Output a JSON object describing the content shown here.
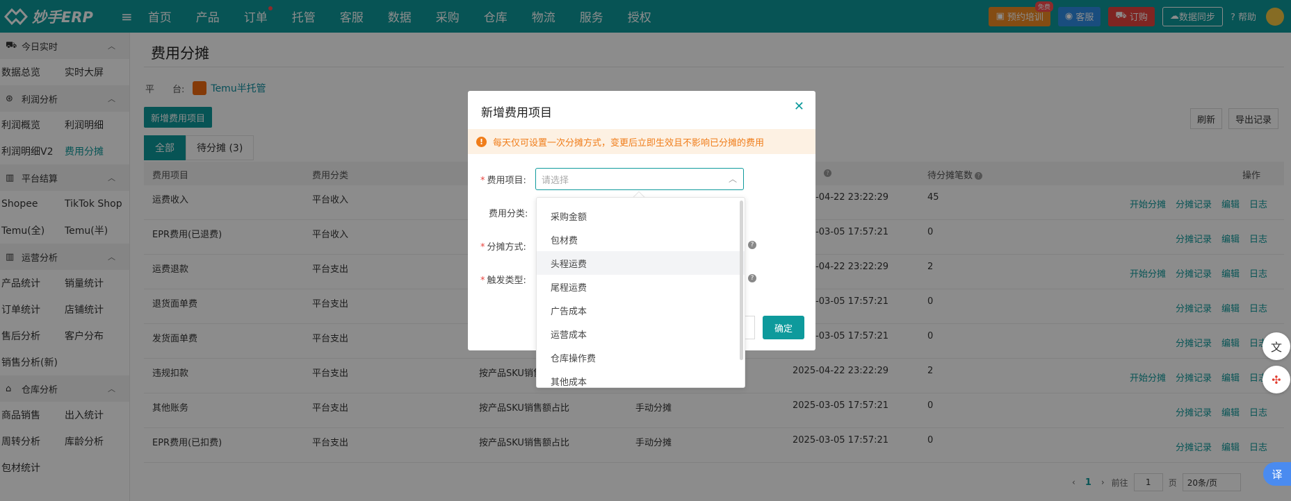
{
  "app": {
    "name": "妙手ERP"
  },
  "nav": [
    "首页",
    "产品",
    "订单",
    "托管",
    "客服",
    "数据",
    "采购",
    "仓库",
    "物流",
    "服务",
    "授权"
  ],
  "top_right": {
    "train": "预约培训",
    "free_badge": "免费",
    "service": "客服",
    "order": "订购",
    "sync": "数据同步",
    "help": "帮助"
  },
  "sidebar": {
    "groups": [
      {
        "title": "今日实时",
        "rows": [
          [
            "数据总览",
            "实时大屏"
          ]
        ]
      },
      {
        "title": "利润分析",
        "rows": [
          [
            "利润概览",
            "利润明细"
          ],
          [
            "利润明细V2",
            "费用分摊"
          ]
        ]
      },
      {
        "title": "平台结算",
        "rows": [
          [
            "Shopee",
            "TikTok Shop"
          ],
          [
            "Temu(全)",
            "Temu(半)"
          ]
        ]
      },
      {
        "title": "运营分析",
        "rows": [
          [
            "产品统计",
            "销量统计"
          ],
          [
            "订单统计",
            "店铺统计"
          ],
          [
            "售后分析",
            "客户分布"
          ],
          [
            "销售分析(新)",
            ""
          ]
        ]
      },
      {
        "title": "仓库分析",
        "rows": [
          [
            "商品销售",
            "出入统计"
          ],
          [
            "周转分析",
            "库龄分析"
          ],
          [
            "包材统计",
            ""
          ]
        ]
      }
    ],
    "active": "费用分摊"
  },
  "page": {
    "title": "费用分摊",
    "platform_label": "平　　台:",
    "platform_value": "Temu半托管",
    "add_button": "新增费用项目",
    "tabs": [
      "全部",
      "待分摊 (3)"
    ],
    "refresh": "刷新",
    "export": "导出记录"
  },
  "table": {
    "headers": [
      "费用项目",
      "费用分类",
      "",
      "",
      "",
      "待分摊笔数",
      "操作"
    ],
    "rows": [
      {
        "item": "运费收入",
        "cat": "平台收入",
        "method": "",
        "type": "",
        "time": "2025-04-22 23:22:29",
        "pending": "45",
        "ops": [
          "开始分摊",
          "分摊记录",
          "编辑",
          "日志"
        ]
      },
      {
        "item": "EPR费用(已退费)",
        "cat": "平台收入",
        "method": "",
        "type": "",
        "time": "2025-03-05 17:57:21",
        "pending": "0",
        "ops": [
          "分摊记录",
          "编辑",
          "日志"
        ]
      },
      {
        "item": "运费退款",
        "cat": "平台支出",
        "method": "",
        "type": "",
        "time": "2025-04-22 23:22:29",
        "pending": "2",
        "ops": [
          "开始分摊",
          "分摊记录",
          "编辑",
          "日志"
        ]
      },
      {
        "item": "退货面单费",
        "cat": "平台支出",
        "method": "",
        "type": "",
        "time": "2025-03-05 17:57:21",
        "pending": "0",
        "ops": [
          "分摊记录",
          "编辑",
          "日志"
        ]
      },
      {
        "item": "发货面单费",
        "cat": "平台支出",
        "method": "",
        "type": "",
        "time": "2025-03-05 17:57:21",
        "pending": "0",
        "ops": [
          "分摊记录",
          "编辑",
          "日志"
        ]
      },
      {
        "item": "违规扣款",
        "cat": "平台支出",
        "method": "按产品SKU销售额",
        "type": "",
        "time": "2025-04-22 23:22:29",
        "pending": "2",
        "ops": [
          "开始分摊",
          "分摊记录",
          "编辑",
          "日志"
        ]
      },
      {
        "item": "其他账务",
        "cat": "平台支出",
        "method": "按产品SKU销售额占比",
        "type": "手动分摊",
        "time": "2025-03-05 17:57:21",
        "pending": "0",
        "ops": [
          "分摊记录",
          "编辑",
          "日志"
        ]
      },
      {
        "item": "EPR费用(已扣费)",
        "cat": "平台支出",
        "method": "按产品SKU销售额占比",
        "type": "手动分摊",
        "time": "2025-03-05 17:57:21",
        "pending": "0",
        "ops": [
          "分摊记录",
          "编辑",
          "日志"
        ]
      }
    ]
  },
  "pager": {
    "prev": "‹",
    "current": "1",
    "next": "›",
    "goto": "前往",
    "page_input": "1",
    "page_unit": "页",
    "size": "20条/页"
  },
  "dialog": {
    "title": "新增费用项目",
    "warning": "每天仅可设置一次分摊方式，变更后立即生效且不影响已分摊的费用",
    "fields": {
      "item": "费用项目:",
      "category": "费用分类:",
      "method": "分摊方式:",
      "trigger": "触发类型:"
    },
    "select_placeholder": "请选择",
    "ok": "确定"
  },
  "dropdown": {
    "items": [
      "采购金额",
      "包材费",
      "头程运费",
      "尾程运费",
      "广告成本",
      "运营成本",
      "仓库操作费",
      "其他成本"
    ],
    "hovered": "头程运费"
  },
  "colors": {
    "primary": "#0e9a9c",
    "warning": "#f07d1a",
    "danger": "#e8443f"
  }
}
